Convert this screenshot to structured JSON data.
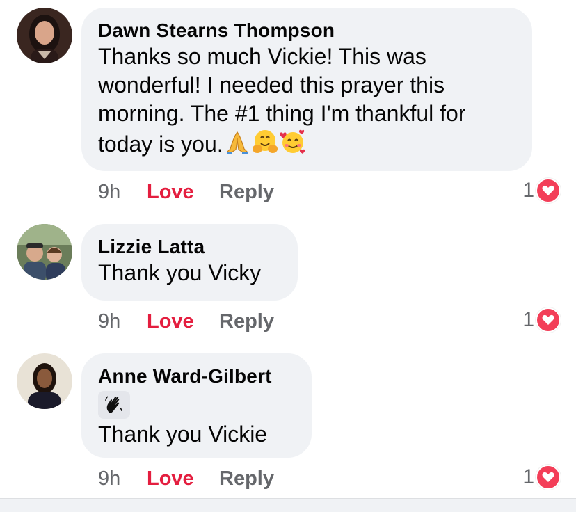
{
  "comments": [
    {
      "author": "Dawn Stearns Thompson",
      "text": "Thanks so much Vickie!  This was\nwonderful!  I needed this prayer this\nmorning. The #1 thing I'm thankful for\ntoday is you.",
      "emojis": [
        "folded-hands",
        "hugging-face",
        "smiling-face-with-hearts"
      ],
      "time": "9h",
      "love_label": "Love",
      "reply_label": "Reply",
      "reaction_count": "1"
    },
    {
      "author": "Lizzie Latta",
      "text": "Thank you Vicky",
      "time": "9h",
      "love_label": "Love",
      "reply_label": "Reply",
      "reaction_count": "1"
    },
    {
      "author": "Anne Ward-Gilbert",
      "sticker": "waving-hand",
      "text": "Thank you Vickie",
      "time": "9h",
      "love_label": "Love",
      "reply_label": "Reply",
      "reaction_count": "1"
    }
  ],
  "colors": {
    "bubble": "#f0f2f5",
    "love": "#e41e3f",
    "meta": "#65676b",
    "heart": "#f33e58"
  }
}
